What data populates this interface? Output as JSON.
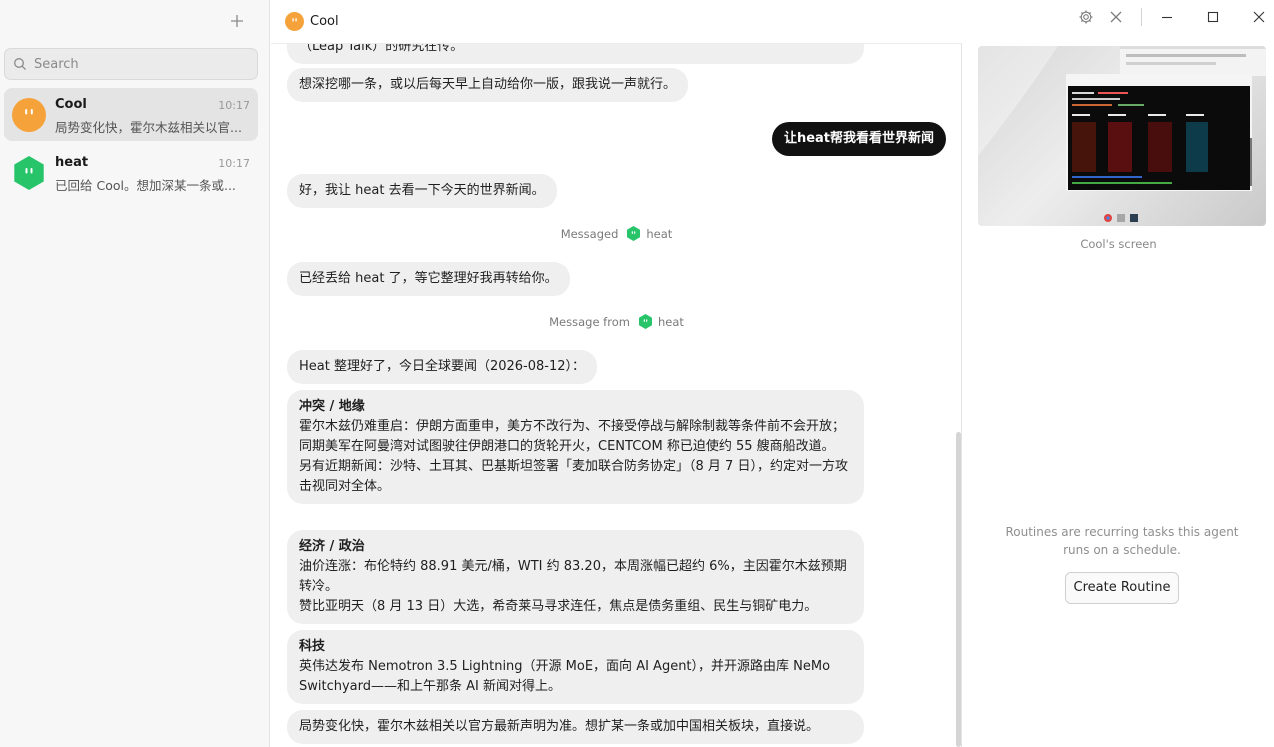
{
  "sidebar": {
    "new_button_icon": "plus-icon",
    "search_placeholder": "Search",
    "conversations": [
      {
        "name": "Cool",
        "time": "10:17",
        "preview": "局势变化快，霍尔木兹相关以官...",
        "avatar_color": "#F5A23A"
      },
      {
        "name": "heat",
        "time": "10:17",
        "preview": "已回给 Cool。想加深某一条或...",
        "avatar_color": "#27C46A"
      }
    ]
  },
  "chat": {
    "title": "Cool",
    "messages": {
      "m0": "（Leap Talk）的研究在传。",
      "m1": "想深挖哪一条，或以后每天早上自动给你一版，跟我说一声就行。",
      "user1": "让heat帮我看看世界新闻",
      "m2": "好，我让 heat 去看一下今天的世界新闻。",
      "sys1_label": "Messaged",
      "sys1_agent": "heat",
      "m3": "已经丢给 heat 了，等它整理好我再转给你。",
      "sys2_label": "Message from",
      "sys2_agent": "heat",
      "m4": "Heat 整理好了，今日全球要闻（2026-08-12）：",
      "conflict_title": "冲突 / 地缘",
      "conflict_p1": "霍尔木兹仍难重启：伊朗方面重申，美方不改行为、不接受停战与解除制裁等条件前不会开放；同期美军在阿曼湾对试图驶往伊朗港口的货轮开火，CENTCOM 称已迫使约 55 艘商船改道。",
      "conflict_p2": "另有近期新闻：沙特、土耳其、巴基斯坦签署「麦加联合防务协定」（8 月 7 日），约定对一方攻击视同对全体。",
      "econ_title": "经济 / 政治",
      "econ_p1": "油价连涨：布伦特约 88.91 美元/桶，WTI 约 83.20，本周涨幅已超约 6%，主因霍尔木兹预期转冷。",
      "econ_p2": "赞比亚明天（8 月 13 日）大选，希奇莱马寻求连任，焦点是债务重组、民生与铜矿电力。",
      "tech_title": "科技",
      "tech_p1": "英伟达发布 Nemotron 3.5 Lightning（开源 MoE，面向 AI Agent），并开源路由库 NeMo Switchyard——和上午那条 AI 新闻对得上。",
      "m5": "局势变化快，霍尔木兹相关以官方最新声明为准。想扩某一条或加中国相关板块，直接说。"
    }
  },
  "right_panel": {
    "screen_caption": "Cool's screen",
    "routines_text": "Routines are recurring tasks this agent runs on a schedule.",
    "create_routine_label": "Create Routine",
    "controls": [
      "gear-icon",
      "close-icon",
      "minimize-icon",
      "maximize-icon",
      "window-close-icon"
    ]
  },
  "colors": {
    "cool_avatar": "#F5A23A",
    "heat_avatar": "#27C46A",
    "user_bubble": "#111111",
    "agent_bubble": "#EFEFEF"
  }
}
